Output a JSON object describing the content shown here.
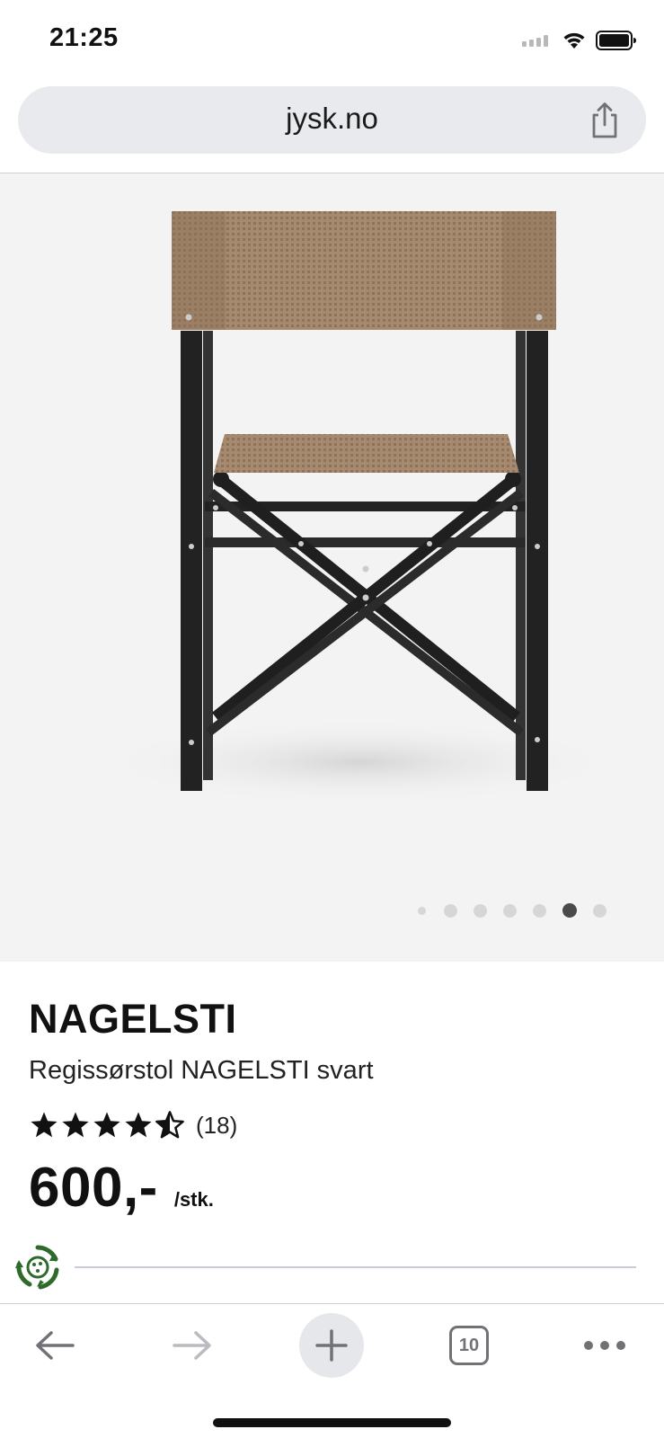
{
  "status_bar": {
    "time": "21:25"
  },
  "browser": {
    "url": "jysk.no",
    "tab_count": "10"
  },
  "gallery": {
    "image_count": 7,
    "active_index": 5
  },
  "product": {
    "name": "NAGELSTI",
    "description": "Regissørstol NAGELSTI svart",
    "rating": 4.5,
    "rating_count": "(18)",
    "price": "600,-",
    "unit": "/stk."
  },
  "colors": {
    "eco_green": "#2e6b2a",
    "toolbar_icon": "#707276",
    "fabric": "#a68a6f",
    "frame": "#222222"
  },
  "icons": [
    "signal-icon",
    "wifi-icon",
    "battery-icon",
    "share-icon",
    "recycle-icon",
    "back-arrow-icon",
    "forward-arrow-icon",
    "plus-icon",
    "tabs-icon",
    "more-icon"
  ]
}
